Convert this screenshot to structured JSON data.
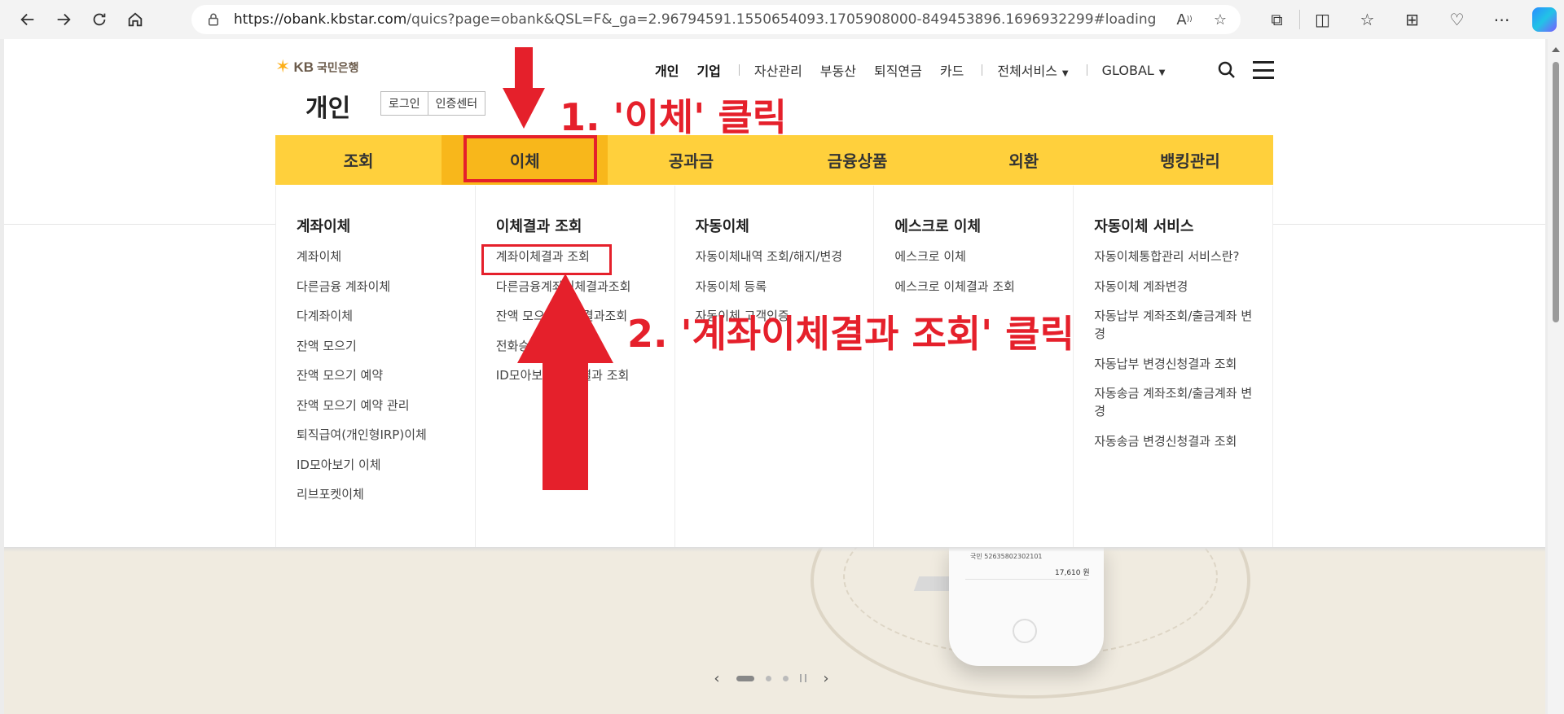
{
  "browser": {
    "url_host": "https://obank.kbstar.com",
    "url_path": "/quics?page=obank&QSL=F&_ga=2.96794591.1550654093.1705908000-849453896.1696932299#loading",
    "nav_icons": [
      "back-icon",
      "forward-icon",
      "refresh-icon",
      "home-icon"
    ],
    "address_icons": [
      "read-aloud-icon",
      "favorite-star-icon"
    ],
    "toolbar_icons": [
      "extensions-icon",
      "split-screen-icon",
      "favorites-icon",
      "collections-icon",
      "browser-essentials-icon",
      "more-icon",
      "copilot-icon"
    ]
  },
  "header": {
    "logo_text": "KB",
    "logo_korean": "국민은행",
    "section_title": "개인",
    "login_label": "로그인",
    "cert_center_label": "인증센터",
    "top_nav": {
      "personal": "개인",
      "corporate": "기업",
      "asset": "자산관리",
      "real_estate": "부동산",
      "pension": "퇴직연금",
      "card": "카드",
      "all_services": "전체서비스",
      "global": "GLOBAL"
    }
  },
  "gnb": {
    "tabs": [
      "조회",
      "이체",
      "공과금",
      "금융상품",
      "외환",
      "뱅킹관리"
    ],
    "active_tab": "이체"
  },
  "menu": {
    "columns": [
      {
        "title": "계좌이체",
        "items": [
          "계좌이체",
          "다른금융 계좌이체",
          "다계좌이체",
          "잔액 모으기",
          "잔액 모으기 예약",
          "잔액 모으기 예약 관리",
          "퇴직급여(개인형IRP)이체",
          "ID모아보기 이체",
          "리브포켓이체"
        ]
      },
      {
        "title": "이체결과 조회",
        "items": [
          "계좌이체결과 조회",
          "다른금융계좌이체결과조회",
          "잔액 모으기 이체결과조회",
          "전화승인 서비스",
          "ID모아보기 이체결과 조회"
        ]
      },
      {
        "title": "자동이체",
        "items": [
          "자동이체내역 조회/해지/변경",
          "자동이체 등록",
          "자동이체 고객인증"
        ]
      },
      {
        "title": "에스크로 이체",
        "items": [
          "에스크로 이체",
          "에스크로 이체결과 조회"
        ]
      },
      {
        "title": "자동이체 서비스",
        "items": [
          "자동이체통합관리 서비스란?",
          "자동이체 계좌변경",
          "자동납부 계좌조회/출금계좌 변경",
          "자동납부 변경신청결과 조회",
          "자동송금 계좌조회/출금계좌 변경",
          "자동송금 변경신청결과 조회"
        ]
      }
    ]
  },
  "hero": {
    "phone_account": "국민 52635802302101",
    "phone_amount": "17,610 원"
  },
  "annotations": {
    "step1": "1. '이체' 클릭",
    "step2": "2. '계좌이체결과 조회' 클릭",
    "color": "#e5202b"
  },
  "colors": {
    "gnb_bg": "#ffd03c",
    "gnb_active": "#f8b71b",
    "hero_bg": "#f0ebe0"
  }
}
